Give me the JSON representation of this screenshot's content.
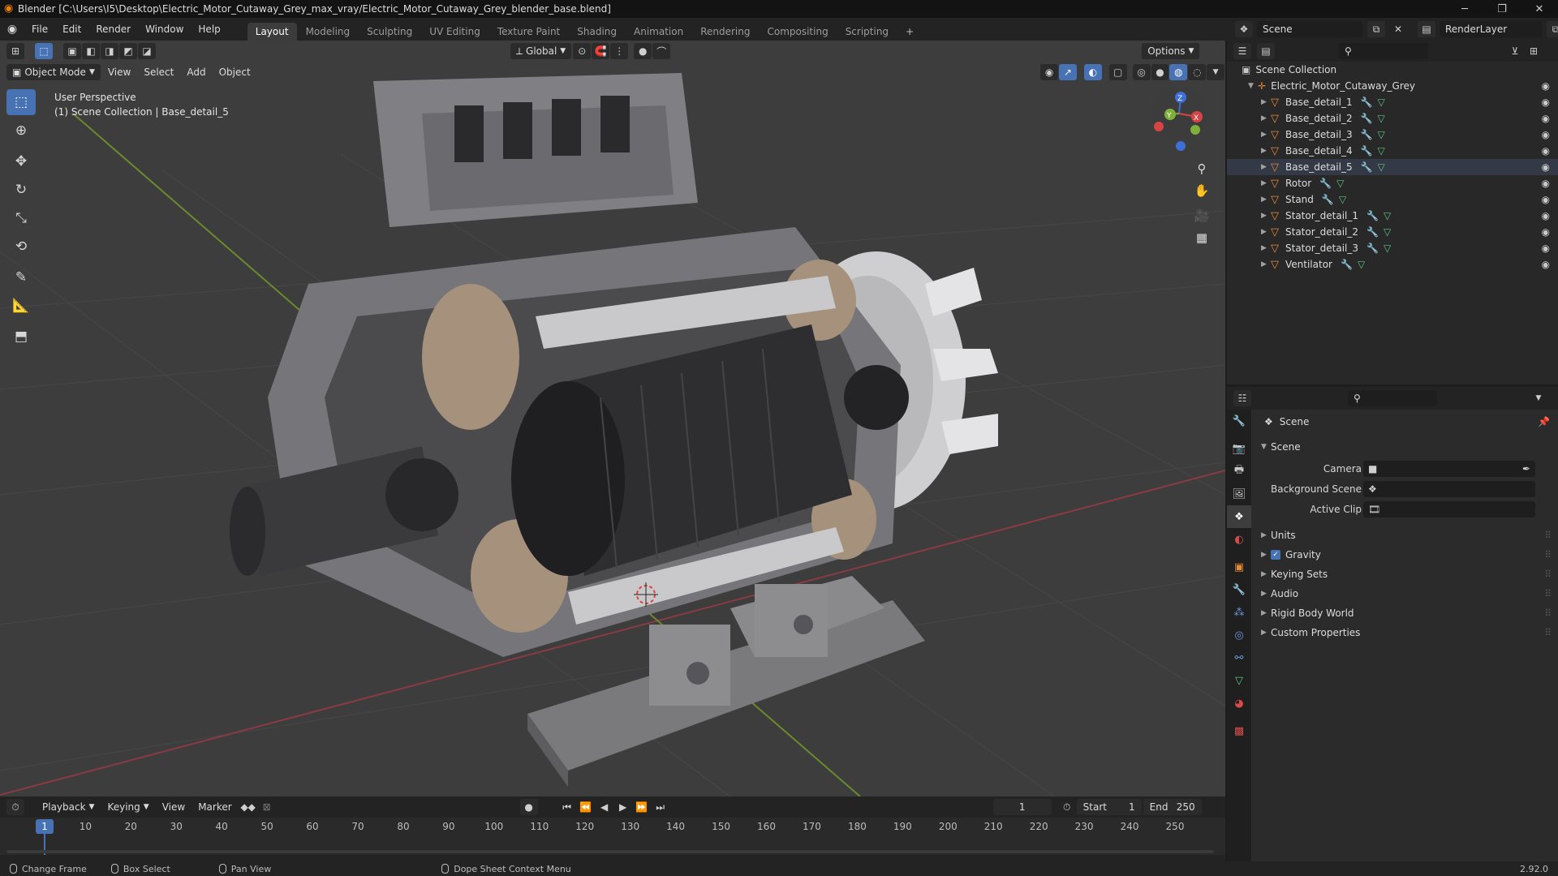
{
  "window": {
    "title": "Blender [C:\\Users\\I5\\Desktop\\Electric_Motor_Cutaway_Grey_max_vray/Electric_Motor_Cutaway_Grey_blender_base.blend]",
    "minimize": "─",
    "maximize": "❐",
    "close": "✕"
  },
  "menu": [
    "File",
    "Edit",
    "Render",
    "Window",
    "Help"
  ],
  "workspaces": [
    "Layout",
    "Modeling",
    "Sculpting",
    "UV Editing",
    "Texture Paint",
    "Shading",
    "Animation",
    "Rendering",
    "Compositing",
    "Scripting"
  ],
  "workspace_add": "+",
  "scene_selector": {
    "value": "Scene",
    "layer": "RenderLayer"
  },
  "viewport": {
    "header": {
      "mode": "Object Mode",
      "menus": [
        "View",
        "Select",
        "Add",
        "Object"
      ]
    },
    "tool_header": {
      "orientation": "Global",
      "options": "Options"
    },
    "overlay_text": {
      "perspective": "User Perspective",
      "collection": "(1) Scene Collection | Base_detail_5"
    },
    "gizmo": {
      "x": "X",
      "y": "Y",
      "z": "Z"
    },
    "accent": "#4772b3"
  },
  "outliner": {
    "root": "Scene Collection",
    "collection": "Electric_Motor_Cutaway_Grey",
    "items": [
      "Base_detail_1",
      "Base_detail_2",
      "Base_detail_3",
      "Base_detail_4",
      "Base_detail_5",
      "Rotor",
      "Stand",
      "Stator_detail_1",
      "Stator_detail_2",
      "Stator_detail_3",
      "Ventilator"
    ],
    "selected": "Base_detail_5"
  },
  "properties": {
    "context": "Scene",
    "panel": "Scene",
    "fields": [
      {
        "label": "Camera",
        "value": ""
      },
      {
        "label": "Background Scene",
        "value": ""
      },
      {
        "label": "Active Clip",
        "value": ""
      }
    ],
    "subpanels": [
      "Units",
      "Gravity",
      "Keying Sets",
      "Audio",
      "Rigid Body World",
      "Custom Properties"
    ],
    "gravity_checked": true
  },
  "timeline": {
    "menus": [
      "Playback",
      "Keying",
      "View",
      "Marker"
    ],
    "current_frame": "1",
    "start_label": "Start",
    "start": "1",
    "end_label": "End",
    "end": "250",
    "ticks": [
      "1",
      "10",
      "20",
      "30",
      "40",
      "50",
      "60",
      "70",
      "80",
      "90",
      "100",
      "110",
      "120",
      "130",
      "140",
      "150",
      "160",
      "170",
      "180",
      "190",
      "200",
      "210",
      "220",
      "230",
      "240",
      "250"
    ]
  },
  "statusbar": {
    "items": [
      "Change Frame",
      "Box Select",
      "Pan View",
      "Dope Sheet Context Menu"
    ],
    "version": "2.92.0"
  }
}
